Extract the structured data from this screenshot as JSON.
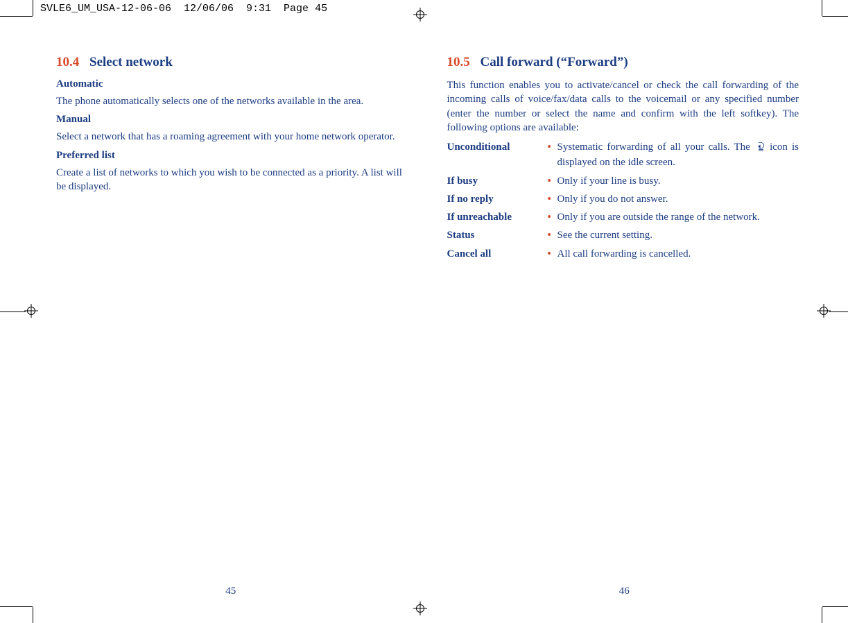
{
  "slug": "SVLE6_UM_USA-12-06-06  12/06/06  9:31  Page 45",
  "left": {
    "section_num": "10.4",
    "section_title": "Select network",
    "automatic": {
      "label": "Automatic",
      "text": "The phone automatically selects one of the networks available in the area."
    },
    "manual": {
      "label": "Manual",
      "text": "Select a network that has a roaming agreement with your home network operator."
    },
    "preferred": {
      "label": "Preferred list",
      "text": "Create a list of networks to which you wish to be connected as a priority. A list will be displayed."
    },
    "page_number": "45"
  },
  "right": {
    "section_num": "10.5",
    "section_title": "Call forward (“Forward”)",
    "intro": "This function enables you to activate/cancel or check the call forwarding of the incoming calls of voice/fax/data calls to the voicemail or any specified number (enter the number or select the name and confirm with the left softkey). The following options are available:",
    "options": [
      {
        "term": "Unconditional",
        "desc_pre": "Systematic forwarding of all your calls. The ",
        "desc_post": "icon is displayed on the idle screen.",
        "icon": true,
        "justify": true
      },
      {
        "term": "If busy",
        "desc": "Only if your line is busy."
      },
      {
        "term": "If no reply",
        "desc": "Only if you do not answer."
      },
      {
        "term": "If unreachable",
        "desc": "Only if you are outside the range of the network.",
        "justify": true
      },
      {
        "term": "Status",
        "desc": "See the current setting."
      },
      {
        "term": "Cancel all",
        "desc": "All call forwarding is cancelled."
      }
    ],
    "page_number": "46"
  }
}
